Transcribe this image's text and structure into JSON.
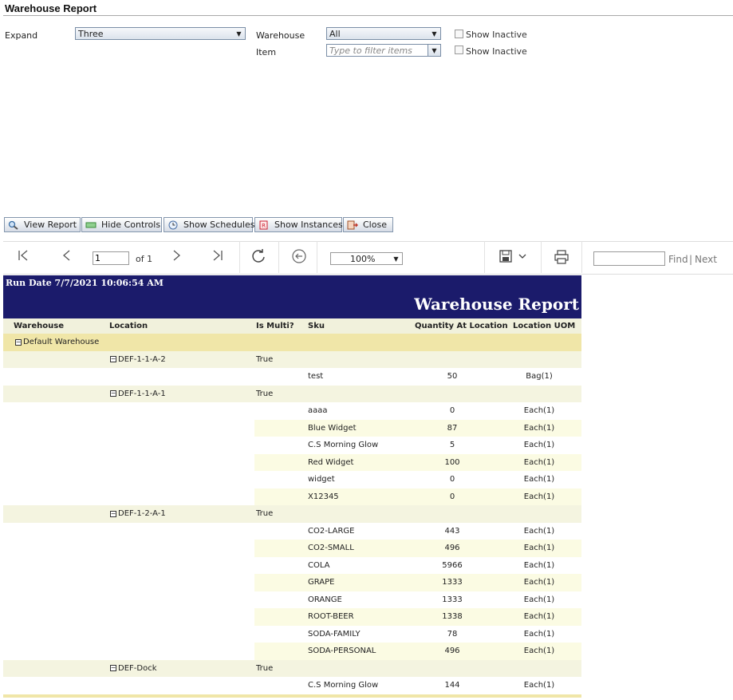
{
  "page_title": "Warehouse Report",
  "params": {
    "expand_label": "Expand",
    "expand_value": "Three",
    "warehouse_label": "Warehouse",
    "warehouse_value": "All",
    "item_label": "Item",
    "item_placeholder": "Type to filter items",
    "show_inactive_1": "Show Inactive",
    "show_inactive_2": "Show Inactive"
  },
  "toolbar": {
    "view_report": "View Report",
    "hide_controls": "Hide Controls",
    "show_schedules": "Show Schedules",
    "show_instances": "Show Instances",
    "close": "Close"
  },
  "viewer": {
    "page_value": "1",
    "of_pages": "of 1",
    "zoom": "100%",
    "find": "Find",
    "separator": "|",
    "next": "Next"
  },
  "report": {
    "run_date": "Run Date 7/7/2021 10:06:54 AM",
    "title": "Warehouse Report",
    "columns": [
      "Warehouse",
      "Location",
      "Is Multi?",
      "Sku",
      "Quantity At Location",
      "Location UOM"
    ],
    "warehouse": "Default Warehouse",
    "locations": [
      {
        "name": "DEF-1-1-A-2",
        "multi": "True",
        "items": [
          {
            "sku": "test",
            "qty": "50",
            "uom": "Bag(1)"
          }
        ]
      },
      {
        "name": "DEF-1-1-A-1",
        "multi": "True",
        "items": [
          {
            "sku": "aaaa",
            "qty": "0",
            "uom": "Each(1)"
          },
          {
            "sku": "Blue Widget",
            "qty": "87",
            "uom": "Each(1)"
          },
          {
            "sku": "C.S Morning Glow",
            "qty": "5",
            "uom": "Each(1)"
          },
          {
            "sku": "Red Widget",
            "qty": "100",
            "uom": "Each(1)"
          },
          {
            "sku": "widget",
            "qty": "0",
            "uom": "Each(1)"
          },
          {
            "sku": "X12345",
            "qty": "0",
            "uom": "Each(1)"
          }
        ]
      },
      {
        "name": "DEF-1-2-A-1",
        "multi": "True",
        "items": [
          {
            "sku": "CO2-LARGE",
            "qty": "443",
            "uom": "Each(1)"
          },
          {
            "sku": "CO2-SMALL",
            "qty": "496",
            "uom": "Each(1)"
          },
          {
            "sku": "COLA",
            "qty": "5966",
            "uom": "Each(1)"
          },
          {
            "sku": "GRAPE",
            "qty": "1333",
            "uom": "Each(1)"
          },
          {
            "sku": "ORANGE",
            "qty": "1333",
            "uom": "Each(1)"
          },
          {
            "sku": "ROOT-BEER",
            "qty": "1338",
            "uom": "Each(1)"
          },
          {
            "sku": "SODA-FAMILY",
            "qty": "78",
            "uom": "Each(1)"
          },
          {
            "sku": "SODA-PERSONAL",
            "qty": "496",
            "uom": "Each(1)"
          }
        ]
      },
      {
        "name": "DEF-Dock",
        "multi": "True",
        "items": [
          {
            "sku": "C.S Morning Glow",
            "qty": "144",
            "uom": "Each(1)"
          }
        ]
      }
    ]
  },
  "colors": {
    "report_header": "#1b1b6b",
    "warehouse_row": "#f0e6a8",
    "location_row": "#f4f4e0",
    "alt_row": "#fbfbe3"
  }
}
